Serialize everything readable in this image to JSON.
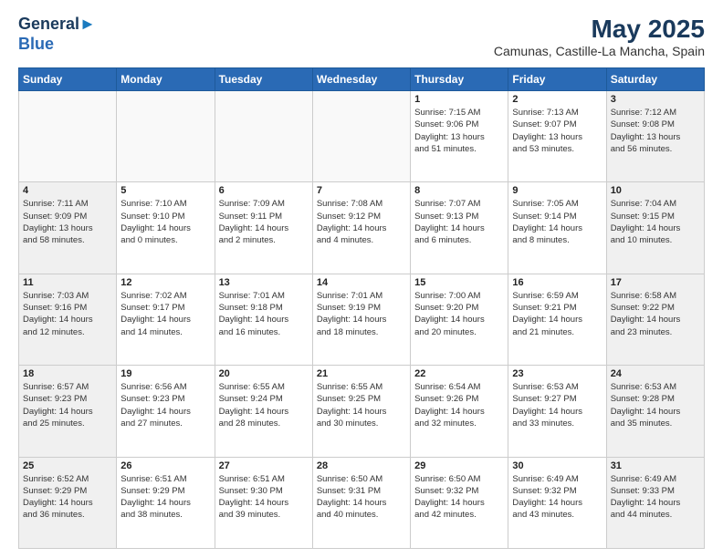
{
  "logo": {
    "line1": "General",
    "line2": "Blue"
  },
  "title": "May 2025",
  "subtitle": "Camunas, Castille-La Mancha, Spain",
  "days_header": [
    "Sunday",
    "Monday",
    "Tuesday",
    "Wednesday",
    "Thursday",
    "Friday",
    "Saturday"
  ],
  "weeks": [
    [
      {
        "day": "",
        "info": ""
      },
      {
        "day": "",
        "info": ""
      },
      {
        "day": "",
        "info": ""
      },
      {
        "day": "",
        "info": ""
      },
      {
        "day": "1",
        "info": "Sunrise: 7:15 AM\nSunset: 9:06 PM\nDaylight: 13 hours\nand 51 minutes."
      },
      {
        "day": "2",
        "info": "Sunrise: 7:13 AM\nSunset: 9:07 PM\nDaylight: 13 hours\nand 53 minutes."
      },
      {
        "day": "3",
        "info": "Sunrise: 7:12 AM\nSunset: 9:08 PM\nDaylight: 13 hours\nand 56 minutes."
      }
    ],
    [
      {
        "day": "4",
        "info": "Sunrise: 7:11 AM\nSunset: 9:09 PM\nDaylight: 13 hours\nand 58 minutes."
      },
      {
        "day": "5",
        "info": "Sunrise: 7:10 AM\nSunset: 9:10 PM\nDaylight: 14 hours\nand 0 minutes."
      },
      {
        "day": "6",
        "info": "Sunrise: 7:09 AM\nSunset: 9:11 PM\nDaylight: 14 hours\nand 2 minutes."
      },
      {
        "day": "7",
        "info": "Sunrise: 7:08 AM\nSunset: 9:12 PM\nDaylight: 14 hours\nand 4 minutes."
      },
      {
        "day": "8",
        "info": "Sunrise: 7:07 AM\nSunset: 9:13 PM\nDaylight: 14 hours\nand 6 minutes."
      },
      {
        "day": "9",
        "info": "Sunrise: 7:05 AM\nSunset: 9:14 PM\nDaylight: 14 hours\nand 8 minutes."
      },
      {
        "day": "10",
        "info": "Sunrise: 7:04 AM\nSunset: 9:15 PM\nDaylight: 14 hours\nand 10 minutes."
      }
    ],
    [
      {
        "day": "11",
        "info": "Sunrise: 7:03 AM\nSunset: 9:16 PM\nDaylight: 14 hours\nand 12 minutes."
      },
      {
        "day": "12",
        "info": "Sunrise: 7:02 AM\nSunset: 9:17 PM\nDaylight: 14 hours\nand 14 minutes."
      },
      {
        "day": "13",
        "info": "Sunrise: 7:01 AM\nSunset: 9:18 PM\nDaylight: 14 hours\nand 16 minutes."
      },
      {
        "day": "14",
        "info": "Sunrise: 7:01 AM\nSunset: 9:19 PM\nDaylight: 14 hours\nand 18 minutes."
      },
      {
        "day": "15",
        "info": "Sunrise: 7:00 AM\nSunset: 9:20 PM\nDaylight: 14 hours\nand 20 minutes."
      },
      {
        "day": "16",
        "info": "Sunrise: 6:59 AM\nSunset: 9:21 PM\nDaylight: 14 hours\nand 21 minutes."
      },
      {
        "day": "17",
        "info": "Sunrise: 6:58 AM\nSunset: 9:22 PM\nDaylight: 14 hours\nand 23 minutes."
      }
    ],
    [
      {
        "day": "18",
        "info": "Sunrise: 6:57 AM\nSunset: 9:23 PM\nDaylight: 14 hours\nand 25 minutes."
      },
      {
        "day": "19",
        "info": "Sunrise: 6:56 AM\nSunset: 9:23 PM\nDaylight: 14 hours\nand 27 minutes."
      },
      {
        "day": "20",
        "info": "Sunrise: 6:55 AM\nSunset: 9:24 PM\nDaylight: 14 hours\nand 28 minutes."
      },
      {
        "day": "21",
        "info": "Sunrise: 6:55 AM\nSunset: 9:25 PM\nDaylight: 14 hours\nand 30 minutes."
      },
      {
        "day": "22",
        "info": "Sunrise: 6:54 AM\nSunset: 9:26 PM\nDaylight: 14 hours\nand 32 minutes."
      },
      {
        "day": "23",
        "info": "Sunrise: 6:53 AM\nSunset: 9:27 PM\nDaylight: 14 hours\nand 33 minutes."
      },
      {
        "day": "24",
        "info": "Sunrise: 6:53 AM\nSunset: 9:28 PM\nDaylight: 14 hours\nand 35 minutes."
      }
    ],
    [
      {
        "day": "25",
        "info": "Sunrise: 6:52 AM\nSunset: 9:29 PM\nDaylight: 14 hours\nand 36 minutes."
      },
      {
        "day": "26",
        "info": "Sunrise: 6:51 AM\nSunset: 9:29 PM\nDaylight: 14 hours\nand 38 minutes."
      },
      {
        "day": "27",
        "info": "Sunrise: 6:51 AM\nSunset: 9:30 PM\nDaylight: 14 hours\nand 39 minutes."
      },
      {
        "day": "28",
        "info": "Sunrise: 6:50 AM\nSunset: 9:31 PM\nDaylight: 14 hours\nand 40 minutes."
      },
      {
        "day": "29",
        "info": "Sunrise: 6:50 AM\nSunset: 9:32 PM\nDaylight: 14 hours\nand 42 minutes."
      },
      {
        "day": "30",
        "info": "Sunrise: 6:49 AM\nSunset: 9:32 PM\nDaylight: 14 hours\nand 43 minutes."
      },
      {
        "day": "31",
        "info": "Sunrise: 6:49 AM\nSunset: 9:33 PM\nDaylight: 14 hours\nand 44 minutes."
      }
    ]
  ]
}
